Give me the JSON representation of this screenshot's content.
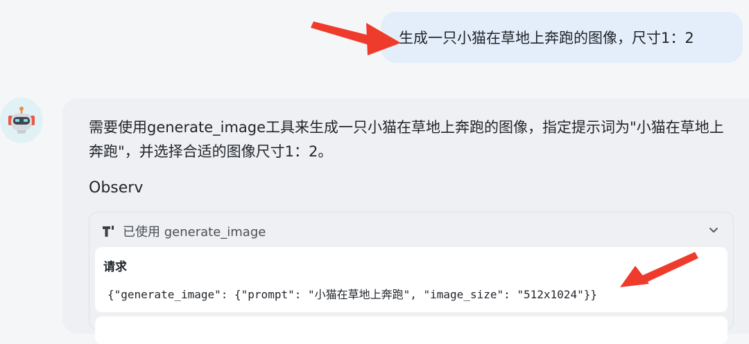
{
  "user_message": "生成一只小猫在草地上奔跑的图像，尺寸1：2",
  "assistant": {
    "text": "需要使用generate_image工具来生成一只小猫在草地上奔跑的图像，指定提示词为\"小猫在草地上奔跑\"，并选择合适的图像尺寸1：2。",
    "observ_label": "Observ",
    "avatar_icon": "robot-icon"
  },
  "tool_call": {
    "header_label": "已使用 generate_image",
    "tool_icon": "tool-icon",
    "request_label": "请求",
    "request_body": "{\"generate_image\": {\"prompt\": \"小猫在草地上奔跑\", \"image_size\": \"512x1024\"}}"
  },
  "colors": {
    "user_bubble": "#e4eefb",
    "assistant_card": "#eef0f3",
    "annotation_arrow": "#ef3b2c"
  }
}
